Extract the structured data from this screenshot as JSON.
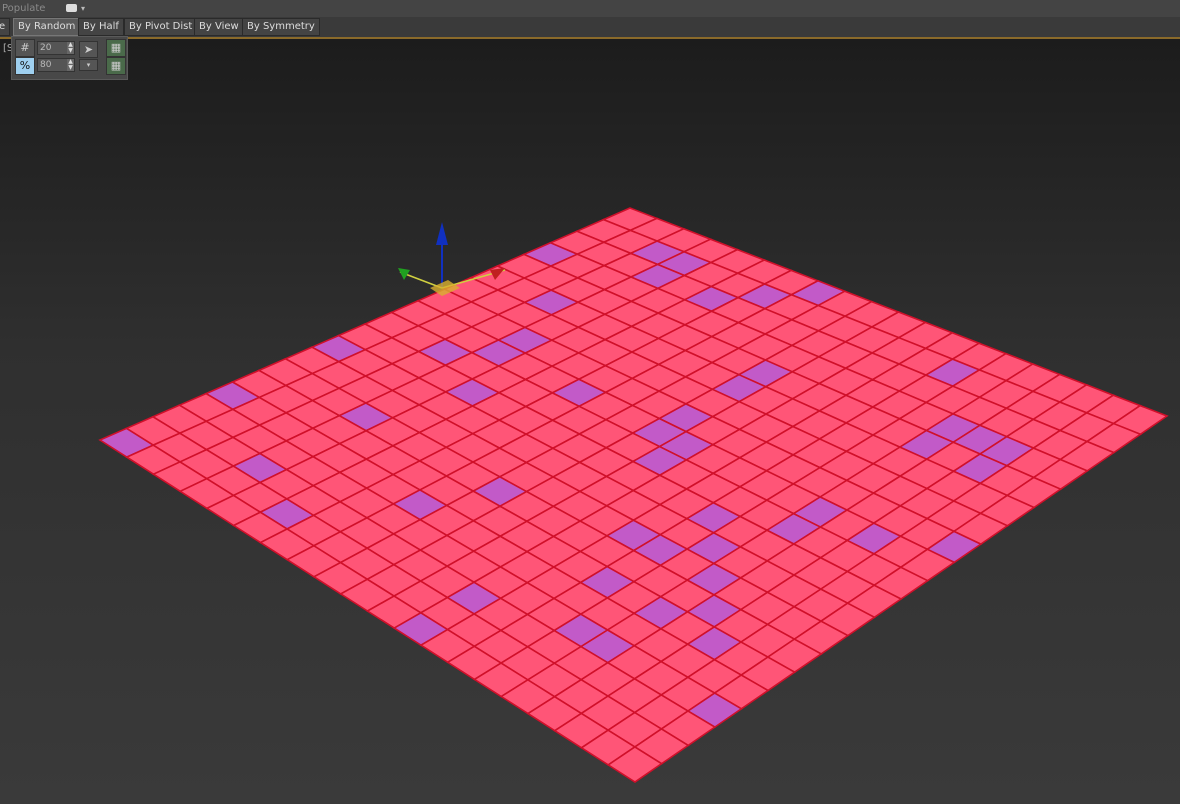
{
  "ribbon": {
    "title": "Populate"
  },
  "tabs": [
    {
      "label": "e"
    },
    {
      "label": "By Random",
      "active": true
    },
    {
      "label": "By Half"
    },
    {
      "label": "By Pivot Dist"
    },
    {
      "label": "By View"
    },
    {
      "label": "By Symmetry"
    }
  ],
  "random_panel": {
    "count_icon": "hash-icon",
    "percent_icon": "percent-icon",
    "count_value": "20",
    "percent_value": "80",
    "percent_active": true
  },
  "viewport": {
    "label": "[S",
    "gizmo_axes": [
      "x",
      "y",
      "z"
    ]
  },
  "colors": {
    "tile": "#ff5577",
    "selected_tile": "#c25ac8",
    "grout": "#d0102a",
    "background": "#2f2f2f"
  },
  "grid": {
    "rows": 20,
    "cols": 20
  }
}
